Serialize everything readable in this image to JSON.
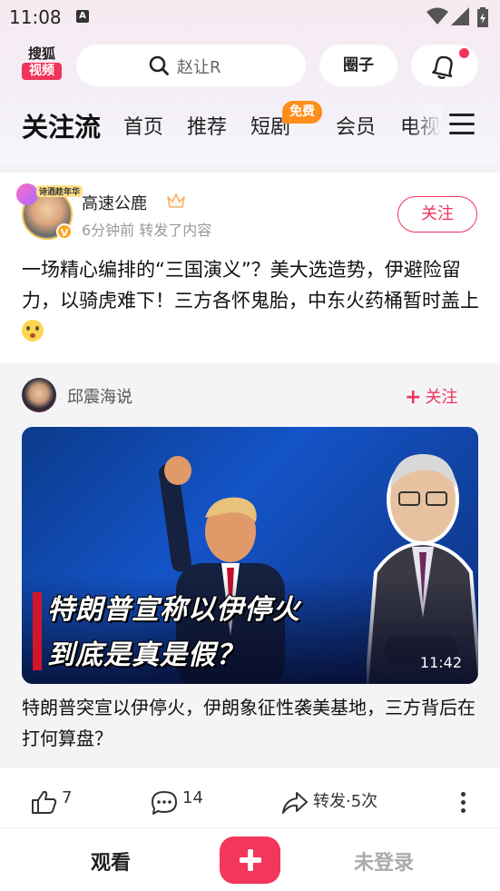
{
  "status_bar": {
    "time": "11:08",
    "app_icon_letter": "A"
  },
  "header": {
    "logo": {
      "line1": "搜狐",
      "line2": "视频"
    },
    "search": {
      "text": "赵让R",
      "icon": "search-icon"
    },
    "circle_button": "圈子",
    "bell_icon": "bell-icon",
    "accent_color": "#f0345a"
  },
  "nav": {
    "tabs": [
      {
        "label": "关注流",
        "active": true
      },
      {
        "label": "首页"
      },
      {
        "label": "推荐"
      },
      {
        "label": "短剧",
        "badge": "免费"
      },
      {
        "label": "会员"
      },
      {
        "label": "电视"
      }
    ],
    "menu_icon": "menu-icon"
  },
  "post": {
    "author": "高速公鹿",
    "avatar_frame_text": "诗酒趁年华",
    "verified_badge": "V",
    "meta": "6分钟前 转发了内容",
    "follow_label": "关注",
    "text": "一场精心编排的“三国演义”？美大选造势，伊避险留力，以骑虎难下！三方各怀鬼胎，中东火药桶暂时盖上"
  },
  "quoted": {
    "author": "邱震海说",
    "follow_plus": "+",
    "follow_label": "关注",
    "video": {
      "title_line1": "特朗普宣称以伊停火",
      "title_line2": "到底是真是假？",
      "duration": "11:42"
    },
    "title": "特朗普突宣以伊停火，伊朗象征性袭美基地，三方背后在打何算盘？"
  },
  "actions": {
    "likes": "7",
    "comments": "14",
    "share_label": "转发·5次"
  },
  "bottom_bar": {
    "watch": "观看",
    "login": "未登录"
  }
}
